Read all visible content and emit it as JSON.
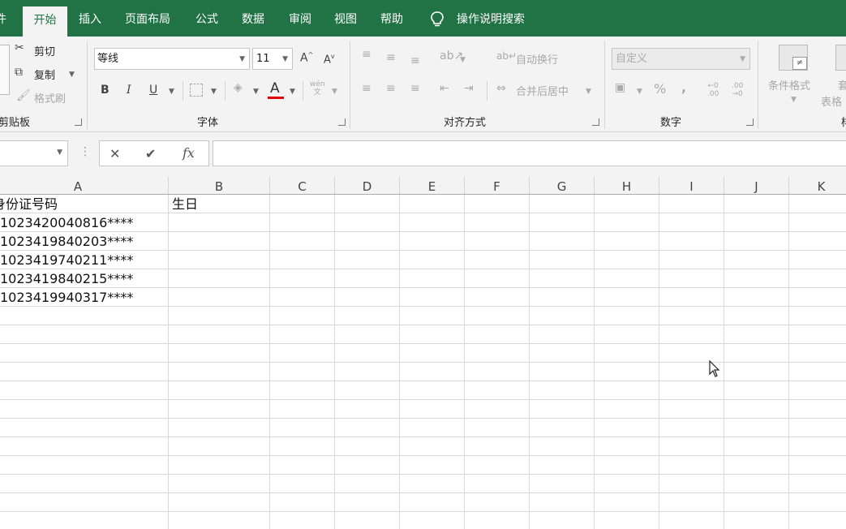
{
  "tabs": {
    "file_partial": "件",
    "items": [
      "开始",
      "插入",
      "页面布局",
      "公式",
      "数据",
      "审阅",
      "视图",
      "帮助"
    ],
    "active": "开始",
    "tell_me": "操作说明搜索"
  },
  "ribbon": {
    "clipboard": {
      "cut": "剪切",
      "copy": "复制",
      "format_painter": "格式刷",
      "label": "剪贴板"
    },
    "font": {
      "name": "等线",
      "size": "11",
      "bold": "B",
      "italic": "I",
      "underline": "U",
      "phonetic": "wén",
      "label": "字体"
    },
    "alignment": {
      "wrap_text": "自动换行",
      "merge_center": "合并后居中",
      "label": "对齐方式"
    },
    "number": {
      "format": "自定义",
      "percent": "%",
      "comma": ",",
      "label": "数字"
    },
    "styles": {
      "conditional_formatting": "条件格式",
      "table_format_partial": "套",
      "table_format_partial2": "表格",
      "label_partial": "样"
    }
  },
  "formula_bar": {
    "name_box": "",
    "cancel": "✕",
    "enter": "✔",
    "fx": "fx",
    "content": ""
  },
  "columns": [
    "A",
    "B",
    "C",
    "D",
    "E",
    "F",
    "G",
    "H",
    "I",
    "J",
    "K"
  ],
  "cells": {
    "A1": "身份证号码",
    "B1": "生日",
    "A2": "1023420040816****",
    "A3": "1023419840203****",
    "A4": "1023419740211****",
    "A5": "1023419840215****",
    "A6": "1023419940317****"
  },
  "colors": {
    "accent": "#217346",
    "ribbon_bg": "#f3f3f3",
    "font_color_bar": "#e00000"
  }
}
